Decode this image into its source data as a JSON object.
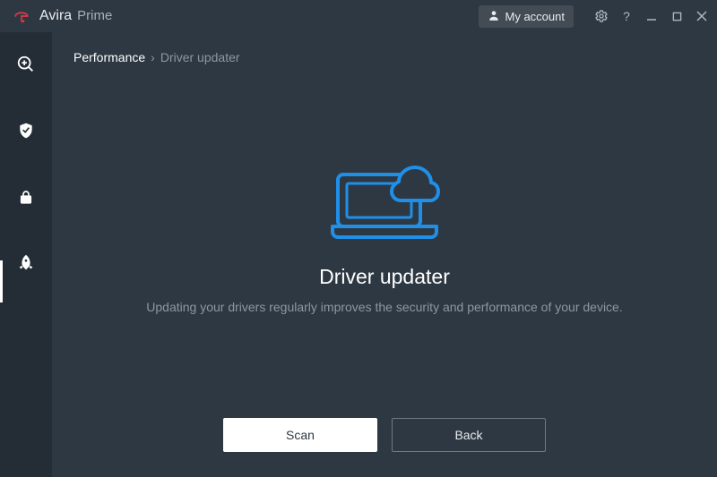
{
  "titlebar": {
    "brand_name": "Avira",
    "brand_tier": "Prime",
    "account_label": "My account"
  },
  "breadcrumb": {
    "root": "Performance",
    "current": "Driver updater"
  },
  "hero": {
    "title": "Driver updater",
    "subtitle": "Updating your drivers regularly improves the security and performance of your device."
  },
  "actions": {
    "primary_label": "Scan",
    "secondary_label": "Back"
  },
  "colors": {
    "accent": "#1f8fe8",
    "bg": "#2e3842",
    "sidebar": "#242d35"
  }
}
